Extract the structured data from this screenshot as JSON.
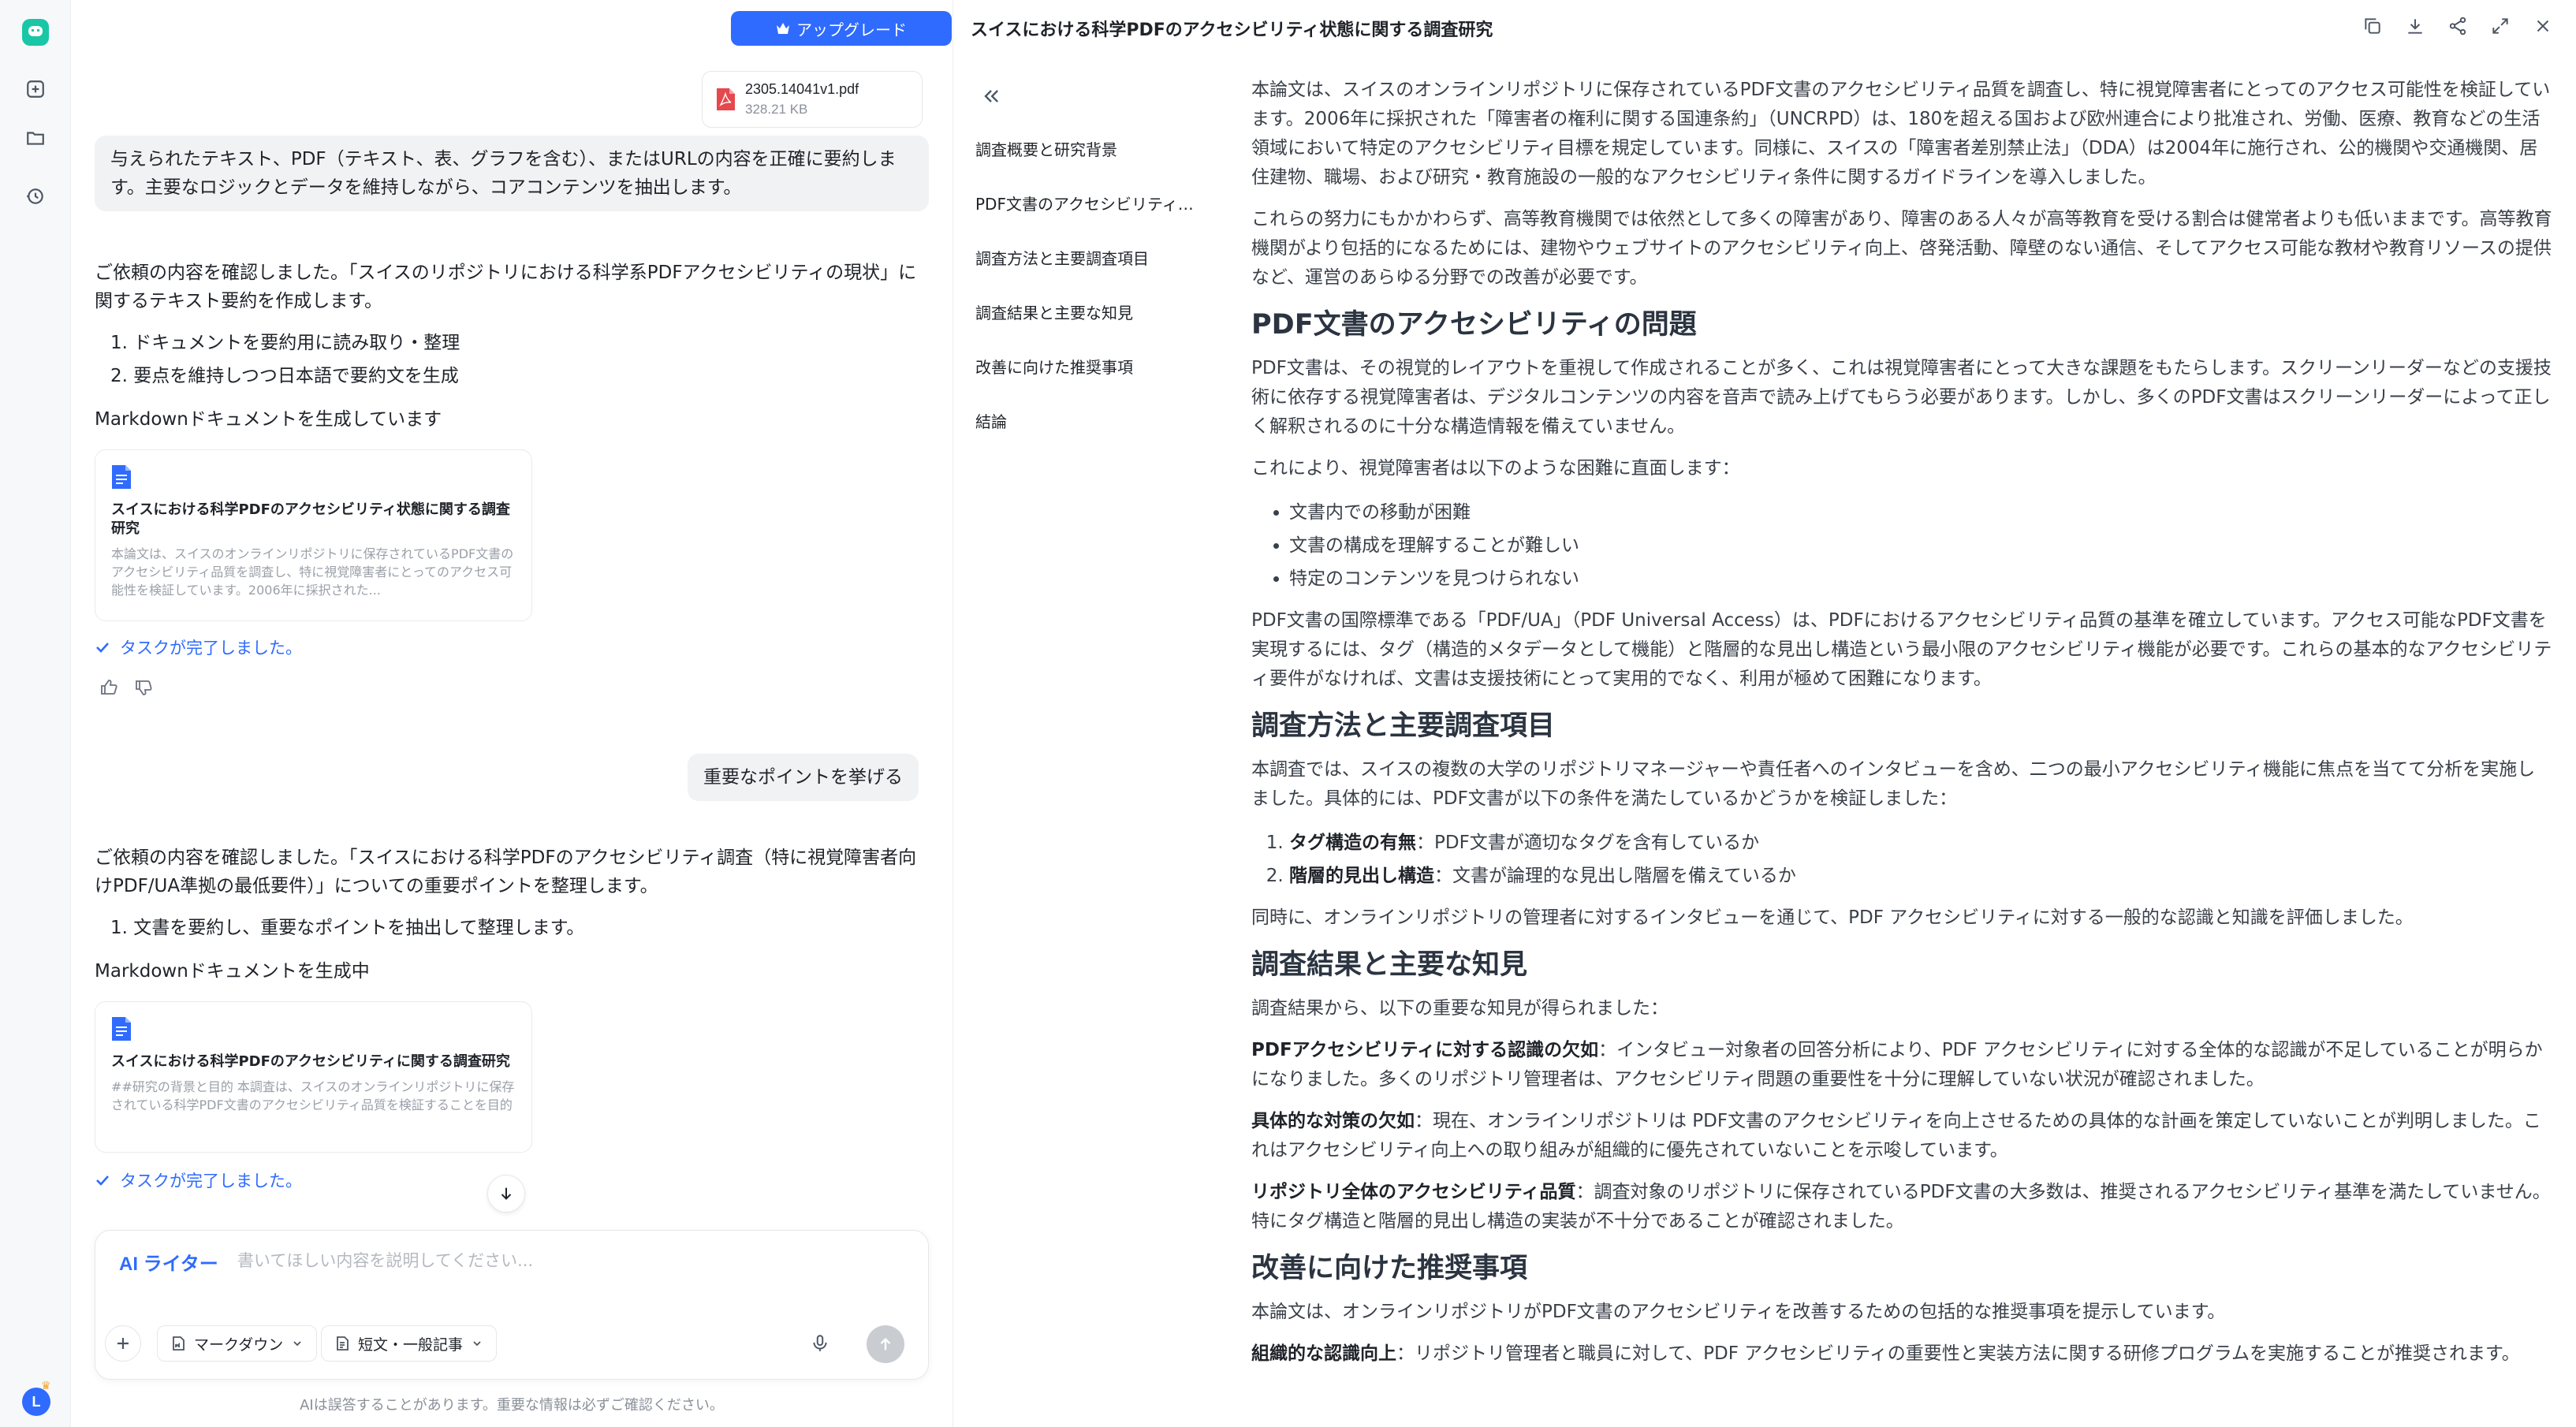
{
  "app": {
    "upgrade_label": "アップグレード",
    "accent_color": "#2f6bff",
    "avatar_initial": "L"
  },
  "file": {
    "name": "2305.14041v1.pdf",
    "size": "328.21 KB"
  },
  "chat": {
    "user_msg_1": "与えられたテキスト、PDF（テキスト、表、グラフを含む）、またはURLの内容を正確に要約します。主要なロジックとデータを維持しながら、コアコンテンツを抽出します。",
    "ai_intro_1": "ご依頼の内容を確認しました。「スイスのリポジトリにおける科学系PDFアクセシビリティの現状」に関するテキスト要約を作成します。",
    "ai_steps_1": [
      "1. ドキュメントを要約用に読み取り・整理",
      "2. 要点を維持しつつ日本語で要約文を生成"
    ],
    "ai_status_1": "Markdownドキュメントを生成しています",
    "doc_card_1": {
      "title": "スイスにおける科学PDFのアクセシビリティ状態に関する調査研究",
      "excerpt": "本論文は、スイスのオンラインリポジトリに保存されているPDF文書のアクセシビリティ品質を調査し、特に視覚障害者にとってのアクセス可能性を検証しています。2006年に採択された..."
    },
    "task_done_1": "タスクが完了しました。",
    "user_msg_2": "重要なポイントを挙げる",
    "ai_intro_2": "ご依頼の内容を確認しました。「スイスにおける科学PDFのアクセシビリティ調査（特に視覚障害者向けPDF/UA準拠の最低要件）」についての重要ポイントを整理します。",
    "ai_steps_2": [
      "1. 文書を要約し、重要なポイントを抽出して整理します。"
    ],
    "ai_status_2": "Markdownドキュメントを生成中",
    "doc_card_2": {
      "title": "スイスにおける科学PDFのアクセシビリティに関する調査研究",
      "excerpt": "##研究の背景と目的 本調査は、スイスのオンラインリポジトリに保存されている科学PDF文書のアクセシビリティ品質を検証することを目的としています。特に視覚障害者にとってのアク..."
    },
    "task_done_2": "タスクが完了しました。"
  },
  "composer": {
    "mode_label": "AI ライター",
    "placeholder": "書いてほしい内容を説明してください...",
    "format_label": "マークダウン",
    "length_label": "短文・一般記事",
    "disclaimer": "AIは誤答することがあります。重要な情報は必ずご確認ください。"
  },
  "doc": {
    "title": "スイスにおける科学PDFのアクセシビリティ状態に関する調査研究",
    "toc": [
      "調査概要と研究背景",
      "PDF文書のアクセシビリティの問題",
      "調査方法と主要調査項目",
      "調査結果と主要な知見",
      "改善に向けた推奨事項",
      "結論"
    ],
    "p1": "本論文は、スイスのオンラインリポジトリに保存されているPDF文書のアクセシビリティ品質を調査し、特に視覚障害者にとってのアクセス可能性を検証しています。2006年に採択された「障害者の権利に関する国連条約」（UNCRPD）は、180を超える国および欧州連合により批准され、労働、医療、教育などの生活領域において特定のアクセシビリティ目標を規定しています。同様に、スイスの「障害者差別禁止法」（DDA）は2004年に施行され、公的機関や交通機関、居住建物、職場、および研究・教育施設の一般的なアクセシビリティ条件に関するガイドラインを導入しました。",
    "p2": "これらの努力にもかかわらず、高等教育機関では依然として多くの障害があり、障害のある人々が高等教育を受ける割合は健常者よりも低いままです。高等教育機関がより包括的になるためには、建物やウェブサイトのアクセシビリティ向上、啓発活動、障壁のない通信、そしてアクセス可能な教材や教育リソースの提供など、運営のあらゆる分野での改善が必要です。",
    "h_pdf": "PDF文書のアクセシビリティの問題",
    "p3": "PDF文書は、その視覚的レイアウトを重視して作成されることが多く、これは視覚障害者にとって大きな課題をもたらします。スクリーンリーダーなどの支援技術に依存する視覚障害者は、デジタルコンテンツの内容を音声で読み上げてもらう必要があります。しかし、多くのPDF文書はスクリーンリーダーによって正しく解釈されるのに十分な構造情報を備えていません。",
    "p4": "これにより、視覚障害者は以下のような困難に直面します：",
    "difficulties": [
      "文書内での移動が困難",
      "文書の構成を理解することが難しい",
      "特定のコンテンツを見つけられない"
    ],
    "p5": "PDF文書の国際標準である「PDF/UA」（PDF Universal Access）は、PDFにおけるアクセシビリティ品質の基準を確立しています。アクセス可能なPDF文書を実現するには、タグ（構造的メタデータとして機能）と階層的な見出し構造という最小限のアクセシビリティ機能が必要です。これらの基本的なアクセシビリティ要件がなければ、文書は支援技術にとって実用的でなく、利用が極めて困難になります。",
    "h_method": "調査方法と主要調査項目",
    "p6": "本調査では、スイスの複数の大学のリポジトリマネージャーや責任者へのインタビューを含め、二つの最小アクセシビリティ機能に焦点を当てて分析を実施しました。具体的には、PDF文書が以下の条件を満たしているかどうかを検証しました：",
    "criteria": [
      {
        "term": "タグ構造の有無",
        "desc": "：PDF文書が適切なタグを含有しているか"
      },
      {
        "term": "階層的見出し構造",
        "desc": "：文書が論理的な見出し階層を備えているか"
      }
    ],
    "p7": "同時に、オンラインリポジトリの管理者に対するインタビューを通じて、PDF アクセシビリティに対する一般的な認識と知識を評価しました。",
    "h_results": "調査結果と主要な知見",
    "p8": "調査結果から、以下の重要な知見が得られました：",
    "f1_term": "PDFアクセシビリティに対する認識の欠如",
    "f1_desc": "：インタビュー対象者の回答分析により、PDF アクセシビリティに対する全体的な認識が不足していることが明らかになりました。多くのリポジトリ管理者は、アクセシビリティ問題の重要性を十分に理解していない状況が確認されました。",
    "f2_term": "具体的な対策の欠如",
    "f2_desc": "：現在、オンラインリポジトリは PDF文書のアクセシビリティを向上させるための具体的な計画を策定していないことが判明しました。これはアクセシビリティ向上への取り組みが組織的に優先されていないことを示唆しています。",
    "f3_term": "リポジトリ全体のアクセシビリティ品質",
    "f3_desc": "：調査対象のリポジトリに保存されているPDF文書の大多数は、推奨されるアクセシビリティ基準を満たしていません。特にタグ構造と階層的見出し構造の実装が不十分であることが確認されました。",
    "h_reco": "改善に向けた推奨事項",
    "p9": "本論文は、オンラインリポジトリがPDF文書のアクセシビリティを改善するための包括的な推奨事項を提示しています。",
    "r1_term": "組織的な認識向上",
    "r1_desc": "：リポジトリ管理者と職員に対して、PDF アクセシビリティの重要性と実装方法に関する研修プログラムを実施することが推奨されます。"
  }
}
